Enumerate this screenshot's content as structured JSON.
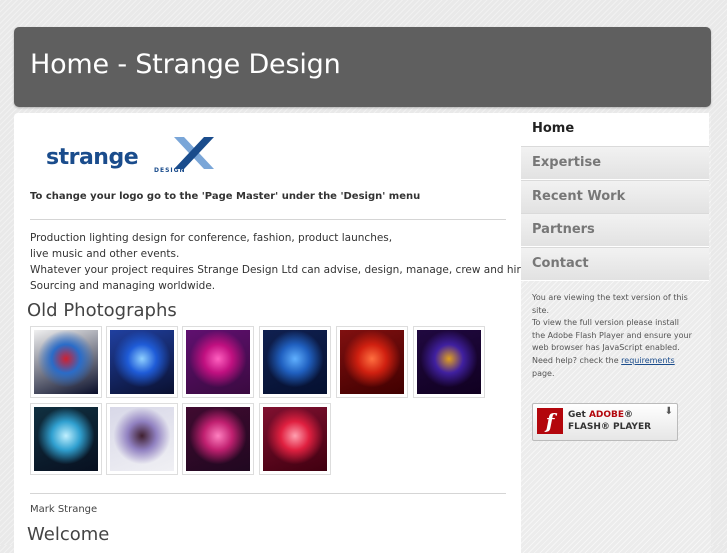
{
  "header": {
    "title": "Home - Strange Design"
  },
  "logo": {
    "text": "strange",
    "sub": "DESIGN"
  },
  "main": {
    "logo_note": "To change your logo go to the 'Page Master' under the 'Design' menu",
    "description_lines": [
      "Production lighting design for conference, fashion, product launches,",
      "live music and other events.",
      "Whatever your project requires Strange Design Ltd can advise, design, manage, crew and hire.",
      "Sourcing and managing worldwide."
    ],
    "gallery_title": "Old Photographs",
    "author": "Mark Strange",
    "welcome": "Welcome"
  },
  "photos": [
    {
      "name": "photo-1",
      "colors": [
        "#0a0f2a",
        "#2a6cc8",
        "#d02030",
        "#f0f0f0"
      ]
    },
    {
      "name": "photo-2",
      "colors": [
        "#0a1030",
        "#1f5cd8",
        "#8fd0ff",
        "#2040a0"
      ]
    },
    {
      "name": "photo-3",
      "colors": [
        "#3a0a40",
        "#c01080",
        "#ff60c0",
        "#601070"
      ]
    },
    {
      "name": "photo-4",
      "colors": [
        "#051030",
        "#2060c0",
        "#60b0ff",
        "#102050"
      ]
    },
    {
      "name": "photo-5",
      "colors": [
        "#400000",
        "#d02010",
        "#ff7040",
        "#801010"
      ]
    },
    {
      "name": "photo-6",
      "colors": [
        "#100020",
        "#4020a0",
        "#e0a020",
        "#200840"
      ]
    },
    {
      "name": "photo-7",
      "colors": [
        "#081020",
        "#30a0d0",
        "#c0f0ff",
        "#103040"
      ]
    },
    {
      "name": "photo-8",
      "colors": [
        "#f0f0f4",
        "#9080c0",
        "#402030",
        "#d8d8e8"
      ]
    },
    {
      "name": "photo-9",
      "colors": [
        "#200820",
        "#c02070",
        "#ff80c0",
        "#400a30"
      ]
    },
    {
      "name": "photo-10",
      "colors": [
        "#400010",
        "#e02040",
        "#ffa0b0",
        "#801030"
      ]
    }
  ],
  "nav": {
    "items": [
      {
        "label": "Home",
        "active": true
      },
      {
        "label": "Expertise",
        "active": false
      },
      {
        "label": "Recent Work",
        "active": false
      },
      {
        "label": "Partners",
        "active": false
      },
      {
        "label": "Contact",
        "active": false
      }
    ]
  },
  "sidebar": {
    "line1": "You are viewing the text version of this site.",
    "line2": "To view the full version please install the Adobe Flash Player and ensure your web browser has JavaScript enabled.",
    "line3_pre": "Need help? check the ",
    "line3_link": "requirements",
    "line3_post": " page."
  },
  "flash_badge": {
    "get": "Get ",
    "adobe": "ADOBE",
    "reg": "®",
    "player": "FLASH® PLAYER"
  },
  "colors": {
    "header_bg": "#5f5f5f",
    "brand_blue": "#1a4c8c",
    "flash_red": "#b3060c"
  }
}
